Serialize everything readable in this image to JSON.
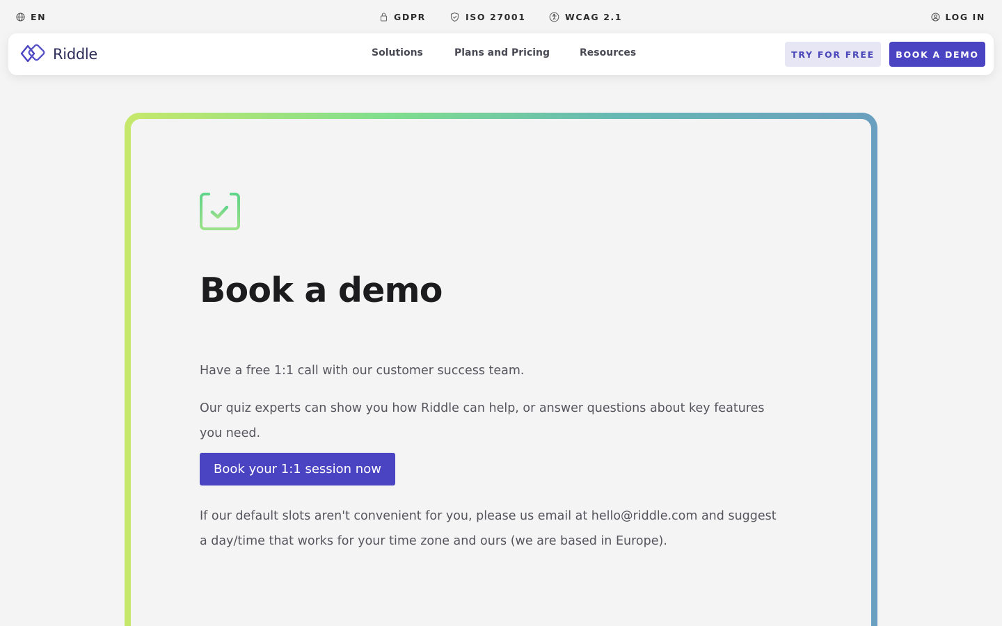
{
  "utility_bar": {
    "language": "EN",
    "badges": [
      {
        "label": "GDPR",
        "icon": "lock-icon"
      },
      {
        "label": "ISO 27001",
        "icon": "shield-check-icon"
      },
      {
        "label": "WCAG 2.1",
        "icon": "accessibility-icon"
      }
    ],
    "login": "LOG IN"
  },
  "navbar": {
    "logo_text": "Riddle",
    "links": [
      "Solutions",
      "Plans and Pricing",
      "Resources"
    ],
    "try_label": "TRY FOR FREE",
    "demo_label": "BOOK A DEMO"
  },
  "card": {
    "icon": "calendar-check-icon",
    "title": "Book a demo",
    "paragraph_1": "Have a free 1:1 call with our customer success team.",
    "paragraph_2": "Our quiz experts can show you how Riddle can help, or answer questions about key features you need.",
    "cta_label": "Book your 1:1 session now",
    "paragraph_3": "If our default slots aren't convenient for you, please us email at hello@riddle.com and suggest a day/time that works for your time zone and ours (we are based in Europe)."
  },
  "colors": {
    "accent": "#4b44c2",
    "accent_light": "#e6e6f5",
    "gradient_start": "#c6e86a",
    "gradient_end": "#6a9fbf"
  }
}
